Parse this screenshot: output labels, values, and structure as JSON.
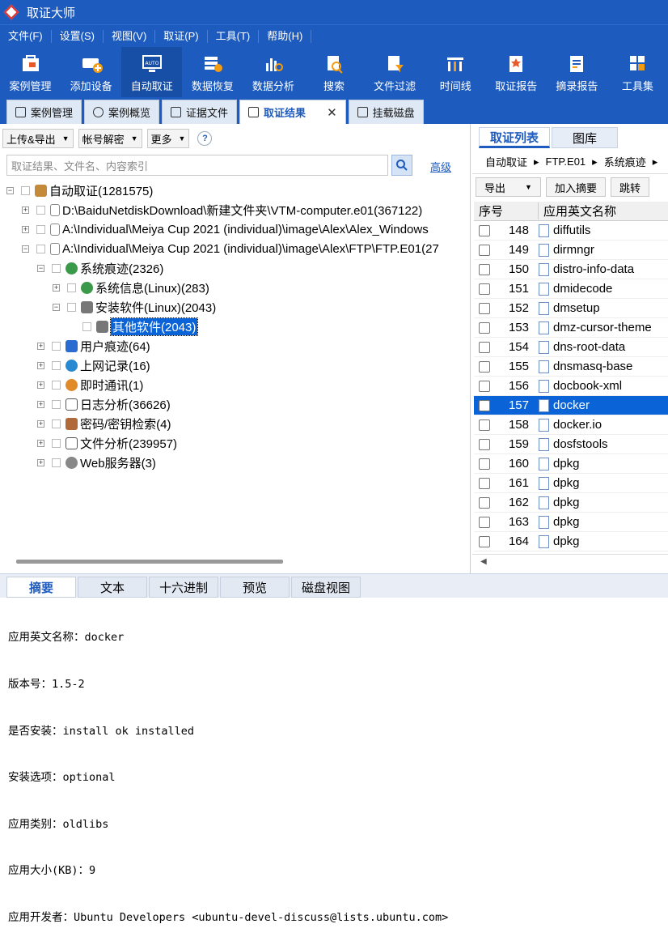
{
  "app": {
    "title": "取证大师"
  },
  "menu": [
    "文件(F)",
    "设置(S)",
    "视图(V)",
    "取证(P)",
    "工具(T)",
    "帮助(H)"
  ],
  "toolbar": [
    "案例管理",
    "添加设备",
    "自动取证",
    "数据恢复",
    "数据分析",
    "搜索",
    "文件过滤",
    "时间线",
    "取证报告",
    "摘录报告",
    "工具集"
  ],
  "tabs": [
    "案例管理",
    "案例概览",
    "证据文件",
    "取证结果",
    "挂载磁盘"
  ],
  "left": {
    "buttons": [
      "上传&导出",
      "帐号解密",
      "更多"
    ],
    "help": "?",
    "search_placeholder": "取证结果、文件名、内容索引",
    "advanced": "高级",
    "tree": [
      "自动取证(1281575)",
      "D:\\BaiduNetdiskDownload\\新建文件夹\\VTM-computer.e01(367122)",
      "A:\\Individual\\Meiya Cup 2021 (individual)\\image\\Alex\\Alex_Windows",
      "A:\\Individual\\Meiya Cup 2021 (individual)\\image\\Alex\\FTP\\FTP.E01(27",
      "系统痕迹(2326)",
      "系统信息(Linux)(283)",
      "安装软件(Linux)(2043)",
      "其他软件(2043)",
      "用户痕迹(64)",
      "上网记录(16)",
      "即时通讯(1)",
      "日志分析(36626)",
      "密码/密钥检索(4)",
      "文件分析(239957)",
      "Web服务器(3)"
    ]
  },
  "right": {
    "tabs": [
      "取证列表",
      "图库"
    ],
    "breadcrumb": [
      "自动取证",
      "FTP.E01",
      "系统痕迹"
    ],
    "buttons": [
      "导出",
      "加入摘要",
      "跳转"
    ],
    "columns": [
      "序号",
      "应用英文名称"
    ],
    "rows": [
      {
        "n": "148",
        "name": "diffutils"
      },
      {
        "n": "149",
        "name": "dirmngr"
      },
      {
        "n": "150",
        "name": "distro-info-data"
      },
      {
        "n": "151",
        "name": "dmidecode"
      },
      {
        "n": "152",
        "name": "dmsetup"
      },
      {
        "n": "153",
        "name": "dmz-cursor-theme"
      },
      {
        "n": "154",
        "name": "dns-root-data"
      },
      {
        "n": "155",
        "name": "dnsmasq-base"
      },
      {
        "n": "156",
        "name": "docbook-xml"
      },
      {
        "n": "157",
        "name": "docker"
      },
      {
        "n": "158",
        "name": "docker.io"
      },
      {
        "n": "159",
        "name": "dosfstools"
      },
      {
        "n": "160",
        "name": "dpkg"
      },
      {
        "n": "161",
        "name": "dpkg"
      },
      {
        "n": "162",
        "name": "dpkg"
      },
      {
        "n": "163",
        "name": "dpkg"
      },
      {
        "n": "164",
        "name": "dpkg"
      }
    ],
    "selected": "157"
  },
  "bottom": {
    "tabs": [
      "摘要",
      "文本",
      "十六进制",
      "预览",
      "磁盘视图"
    ],
    "lines": [
      "应用英文名称：docker",
      "版本号：1.5-2",
      "是否安装：install ok installed",
      "安装选项：optional",
      "应用类别：oldlibs",
      "应用大小(KB)：9",
      "应用开发者：Ubuntu Developers <ubuntu-devel-discuss@lists.ubuntu.com>"
    ]
  }
}
